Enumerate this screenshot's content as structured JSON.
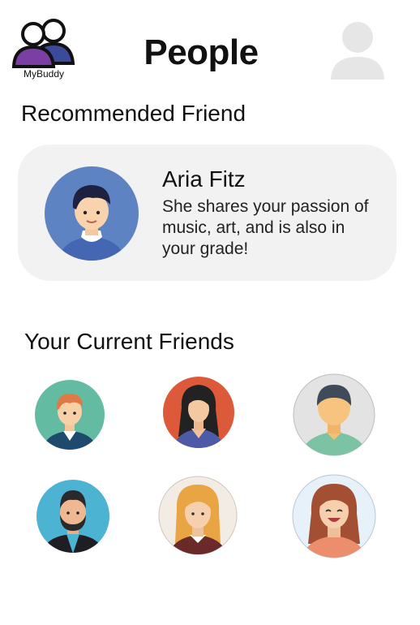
{
  "app": {
    "logo_text": "MyBuddy"
  },
  "header": {
    "title": "People"
  },
  "recommended": {
    "section_title": "Recommended Friend",
    "name": "Aria Fitz",
    "description": "She shares your passion of music, art, and is also in your grade!"
  },
  "current_friends": {
    "section_title": "Your Current Friends",
    "count": 6
  },
  "icons": {
    "logo": "two-people-icon",
    "profile": "user-profile-icon"
  },
  "colors": {
    "logo_purple": "#7b3fa3",
    "logo_navy": "#3c4a9a",
    "card_bg": "#f2f2f2",
    "profile_gray": "#e6e6e6"
  }
}
